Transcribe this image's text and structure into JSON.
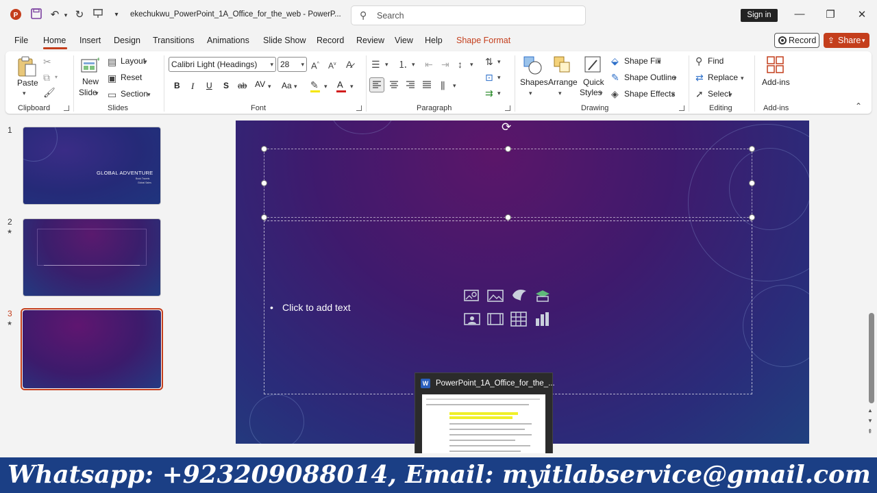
{
  "titlebar": {
    "doc_title": "ekechukwu_PowerPoint_1A_Office_for_the_web - PowerP...",
    "search_placeholder": "Search",
    "sign_in": "Sign in"
  },
  "menu": {
    "items": [
      "File",
      "Home",
      "Insert",
      "Design",
      "Transitions",
      "Animations",
      "Slide Show",
      "Record",
      "Review",
      "View",
      "Help",
      "Shape Format"
    ],
    "active": "Home",
    "record_label": "Record",
    "share_label": "Share"
  },
  "ribbon": {
    "clipboard": {
      "paste": "Paste",
      "label": "Clipboard"
    },
    "slides": {
      "new_slide_1": "New",
      "new_slide_2": "Slide",
      "layout": "Layout",
      "reset": "Reset",
      "section": "Section",
      "label": "Slides"
    },
    "font": {
      "family": "Calibri Light (Headings)",
      "size": "28",
      "bold": "B",
      "italic": "I",
      "underline": "U",
      "shadow": "S",
      "strike": "ab",
      "spacing": "AV",
      "case": "Aa",
      "color": "A",
      "label": "Font"
    },
    "paragraph": {
      "label": "Paragraph"
    },
    "drawing": {
      "shapes": "Shapes",
      "arrange": "Arrange",
      "quick_1": "Quick",
      "quick_2": "Styles",
      "shape_fill": "Shape Fill",
      "shape_outline": "Shape Outline",
      "shape_effects": "Shape Effects",
      "label": "Drawing"
    },
    "editing": {
      "find": "Find",
      "replace": "Replace",
      "select": "Select",
      "label": "Editing"
    },
    "addins": {
      "button": "Add-ins",
      "label": "Add-ins"
    }
  },
  "slides_panel": {
    "slides": [
      {
        "number": "1",
        "title": "GLOBAL ADVENTURE",
        "sub1": "Book Travels",
        "sub2": "Global Sales"
      },
      {
        "number": "2",
        "star": "★"
      },
      {
        "number": "3",
        "star": "★"
      }
    ]
  },
  "slide": {
    "bullet": "•",
    "body_placeholder": "Click to add text"
  },
  "popup": {
    "title": "PowerPoint_1A_Office_for_the_...",
    "app_letter": "W"
  },
  "banner": {
    "text": "Whatsapp: +923209088014, Email: myitlabservice@gmail.com"
  },
  "colors": {
    "accent": "#c43e1c",
    "banner": "#1b3f85"
  }
}
